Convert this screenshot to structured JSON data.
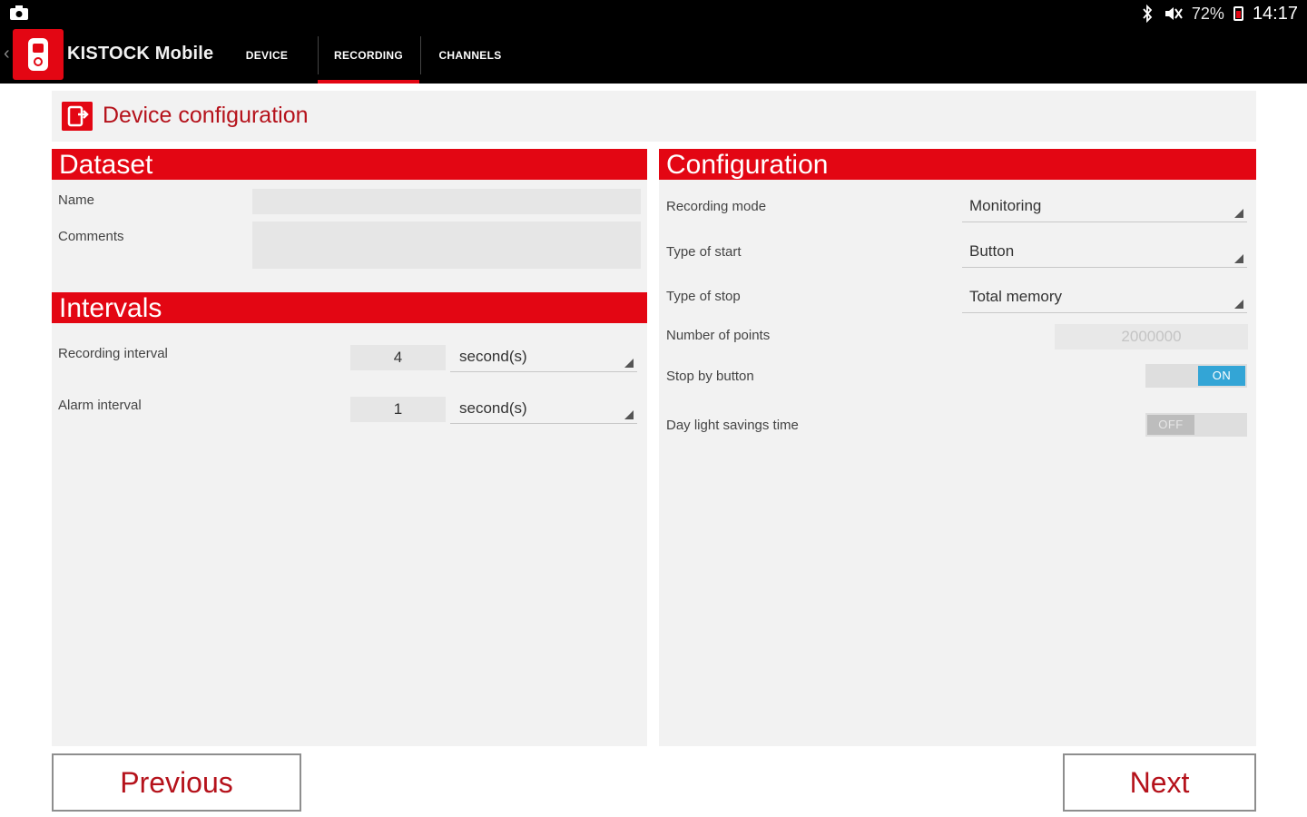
{
  "status_bar": {
    "battery_percent": "72%",
    "clock": "14:17",
    "icons": [
      "screenshot-icon",
      "bluetooth-icon",
      "mute-icon",
      "battery-icon"
    ]
  },
  "app": {
    "title": "KISTOCK Mobile",
    "tabs": [
      {
        "label": "DEVICE",
        "active": false
      },
      {
        "label": "RECORDING",
        "active": true
      },
      {
        "label": "CHANNELS",
        "active": false
      }
    ]
  },
  "header": {
    "title": "Device configuration"
  },
  "dataset": {
    "heading": "Dataset",
    "name_label": "Name",
    "name_value": "",
    "comments_label": "Comments",
    "comments_value": ""
  },
  "intervals": {
    "heading": "Intervals",
    "recording_label": "Recording interval",
    "recording_value": "4",
    "recording_unit": "second(s)",
    "alarm_label": "Alarm interval",
    "alarm_value": "1",
    "alarm_unit": "second(s)"
  },
  "configuration": {
    "heading": "Configuration",
    "recording_mode_label": "Recording mode",
    "recording_mode_value": "Monitoring",
    "start_label": "Type of start",
    "start_value": "Button",
    "stop_label": "Type of stop",
    "stop_value": "Total memory",
    "points_label": "Number of points",
    "points_value": "2000000",
    "stop_button_label": "Stop by button",
    "stop_button_state": "ON",
    "dst_label": "Day light savings time",
    "dst_state": "OFF"
  },
  "footer": {
    "previous_label": "Previous",
    "next_label": "Next"
  },
  "colors": {
    "accent": "#e30613",
    "title_text": "#b5121b",
    "toggle_on": "#33a5d6",
    "bar_bg": "#000000"
  }
}
